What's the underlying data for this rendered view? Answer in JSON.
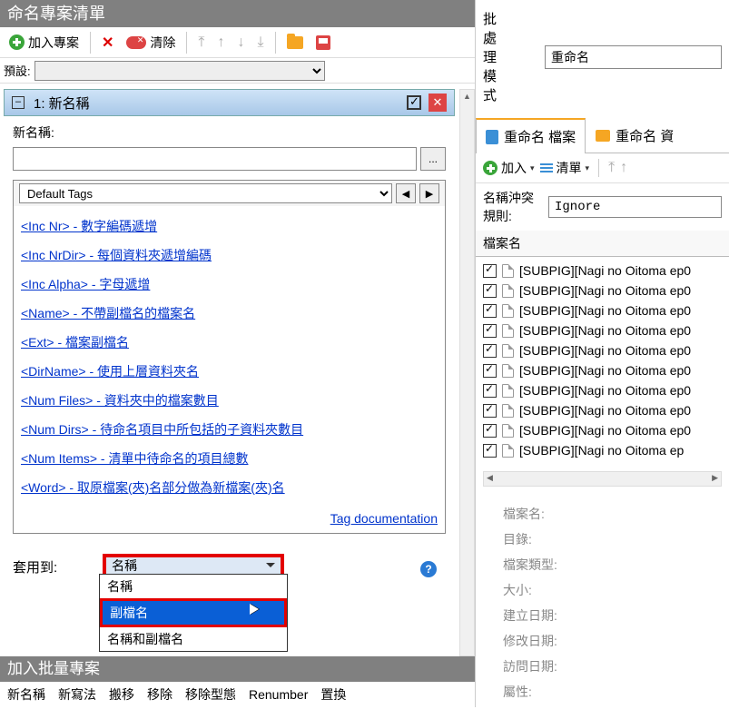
{
  "leftPane": {
    "titleBar": "命名專案清單",
    "toolbar": {
      "addProject": "加入專案",
      "clear": "清除"
    },
    "presetLabel": "預設:",
    "project": {
      "header": "1: 新名稱",
      "newNameLabel": "新名稱:",
      "browseBtn": "...",
      "defaultTags": "Default Tags",
      "tags": [
        "<Inc Nr> - 數字編碼遞增",
        "<Inc NrDir> - 每個資料夾遞增編碼",
        "<Inc Alpha> - 字母遞增",
        "<Name> - 不帶副檔名的檔案名",
        "<Ext> - 檔案副檔名",
        "<DirName> - 使用上層資料夾名",
        "<Num Files> - 資料夾中的檔案數目",
        "<Num Dirs> - 待命名項目中所包括的子資料夾數目",
        "<Num Items> - 清單中待命名的項目總數",
        "<Word> - 取原檔案(夾)名部分做為新檔案(夾)名"
      ],
      "tagDocLink": "Tag documentation",
      "applyToLabel": "套用到:",
      "applyToSelected": "名稱",
      "applyToOptions": [
        "名稱",
        "副檔名",
        "名稱和副檔名"
      ]
    },
    "batchTitle": "加入批量專案",
    "footerMenus": [
      "新名稱",
      "新寫法",
      "搬移",
      "移除",
      "移除型態",
      "Renumber",
      "置換"
    ]
  },
  "rightPane": {
    "modeLabel": "批處理模式",
    "modeValue": "重命名",
    "tabs": {
      "files": "重命名 檔案",
      "folders": "重命名 資"
    },
    "toolbar": {
      "add": "加入",
      "list": "清單"
    },
    "conflictLabel": "名稱沖突規則:",
    "conflictValue": "Ignore",
    "listHeader": "檔案名",
    "items": [
      "[SUBPIG][Nagi no Oitoma ep0",
      "[SUBPIG][Nagi no Oitoma ep0",
      "[SUBPIG][Nagi no Oitoma ep0",
      "[SUBPIG][Nagi no Oitoma ep0",
      "[SUBPIG][Nagi no Oitoma ep0",
      "[SUBPIG][Nagi no Oitoma ep0",
      "[SUBPIG][Nagi no Oitoma ep0",
      "[SUBPIG][Nagi no Oitoma ep0",
      "[SUBPIG][Nagi no Oitoma ep0",
      "[SUBPIG][Nagi no Oitoma ep"
    ],
    "meta": [
      "檔案名:",
      "目錄:",
      "檔案類型:",
      "大小:",
      "建立日期:",
      "修改日期:",
      "訪問日期:",
      "屬性:"
    ]
  }
}
